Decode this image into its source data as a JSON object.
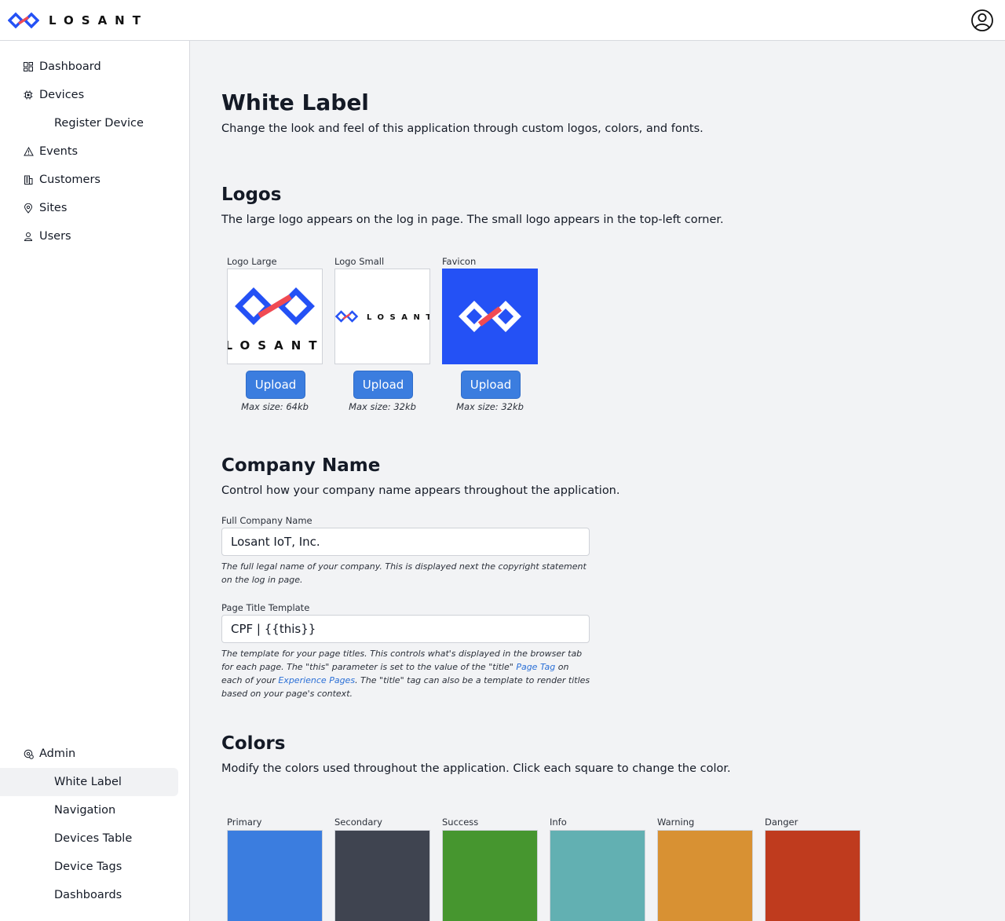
{
  "brand": {
    "name": "LOSANT"
  },
  "sidebar": {
    "items": [
      {
        "label": "Dashboard",
        "icon": "dashboard-icon"
      },
      {
        "label": "Devices",
        "icon": "device-icon"
      },
      {
        "label": "Register Device"
      },
      {
        "label": "Events",
        "icon": "warning-icon"
      },
      {
        "label": "Customers",
        "icon": "building-icon"
      },
      {
        "label": "Sites",
        "icon": "location-pin-icon"
      },
      {
        "label": "Users",
        "icon": "user-icon"
      }
    ],
    "admin": {
      "label": "Admin",
      "icon": "admin-gear-icon",
      "items": [
        {
          "label": "White Label",
          "active": true
        },
        {
          "label": "Navigation"
        },
        {
          "label": "Devices Table"
        },
        {
          "label": "Device Tags"
        },
        {
          "label": "Dashboards"
        }
      ]
    }
  },
  "page": {
    "title": "White Label",
    "subtitle": "Change the look and feel of this application through custom logos, colors, and fonts."
  },
  "logos": {
    "heading": "Logos",
    "description": "The large logo appears on the log in page. The small logo appears in the top-left corner.",
    "items": [
      {
        "label": "Logo Large",
        "button": "Upload",
        "max": "Max size: 64kb",
        "logo_text": "LOSANT"
      },
      {
        "label": "Logo Small",
        "button": "Upload",
        "max": "Max size: 32kb",
        "logo_text": "LOSANT"
      },
      {
        "label": "Favicon",
        "button": "Upload",
        "max": "Max size: 32kb"
      }
    ]
  },
  "company": {
    "heading": "Company Name",
    "description": "Control how your company name appears throughout the application.",
    "full_name": {
      "label": "Full Company Name",
      "value": "Losant IoT, Inc.",
      "help": "The full legal name of your company. This is displayed next the copyright statement on the log in page."
    },
    "title_template": {
      "label": "Page Title Template",
      "value": "CPF | {{this}}",
      "help_1": "The template for your page titles. This controls what's displayed in the browser tab for each page. The \"this\" parameter is set to the value of the \"title\"",
      "link_1": "Page Tag",
      "help_2": "on each of your",
      "link_2": "Experience Pages",
      "help_3": ". The \"title\" tag can also be a template to render titles based on your page's context."
    }
  },
  "colors": {
    "heading": "Colors",
    "description": "Modify the colors used throughout the application. Click each square to change the color.",
    "swatches": [
      {
        "label": "Primary",
        "color": "#3b7ddf"
      },
      {
        "label": "Secondary",
        "color": "#3f4450"
      },
      {
        "label": "Success",
        "color": "#46962f"
      },
      {
        "label": "Info",
        "color": "#62b0b2"
      },
      {
        "label": "Warning",
        "color": "#d89133"
      },
      {
        "label": "Danger",
        "color": "#bf3b1e"
      }
    ]
  },
  "theme": {
    "brand_blue": "#2451f5",
    "brand_red": "#f04a53"
  }
}
